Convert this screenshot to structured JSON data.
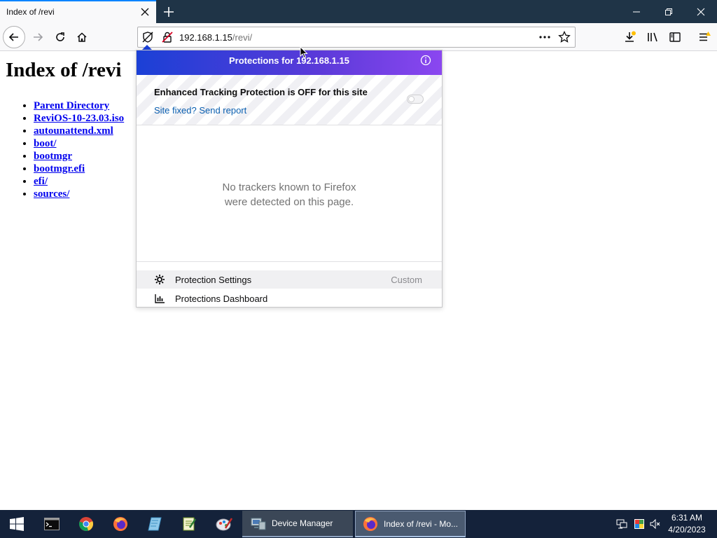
{
  "browser": {
    "tab_title": "Index of /revi",
    "url_host": "192.168.1.15",
    "url_path": "/revi/",
    "accent_color": "#0a84ff"
  },
  "page": {
    "title": "Index of /revi",
    "links": [
      "Parent Directory",
      "ReviOS-10-23.03.iso",
      "autounattend.xml",
      "boot/",
      "bootmgr",
      "bootmgr.efi",
      "efi/",
      "sources/"
    ]
  },
  "protections_panel": {
    "header": "Protections for 192.168.1.15",
    "etp_status": "Enhanced Tracking Protection is OFF for this site",
    "report_link": "Site fixed? Send report",
    "empty_line1": "No trackers known to Firefox",
    "empty_line2": "were detected on this page.",
    "settings_label": "Protection Settings",
    "settings_value": "Custom",
    "dashboard_label": "Protections Dashboard",
    "toggle_on": false
  },
  "taskbar": {
    "windows": [
      "Device Manager",
      "Index of /revi - Mo..."
    ],
    "time": "6:31 AM",
    "date": "4/20/2023"
  }
}
